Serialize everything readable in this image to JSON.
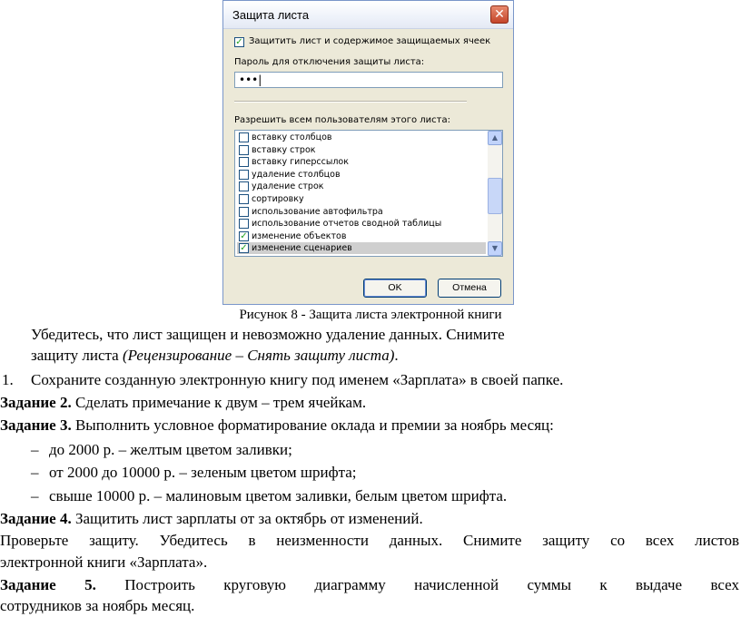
{
  "dialog": {
    "title": "Защита листа",
    "close_glyph": "✕",
    "protect_label": "Защитить лист и содержимое защищаемых ячеек",
    "protect_checked": true,
    "password_label": "Пароль для отключения защиты листа:",
    "password_value": "•••|",
    "allow_label": "Разрешить всем пользователям этого листа:",
    "allow_items": [
      {
        "label": "вставку столбцов",
        "checked": false
      },
      {
        "label": "вставку строк",
        "checked": false
      },
      {
        "label": "вставку гиперссылок",
        "checked": false
      },
      {
        "label": "удаление столбцов",
        "checked": false
      },
      {
        "label": "удаление строк",
        "checked": false
      },
      {
        "label": "сортировку",
        "checked": false
      },
      {
        "label": "использование автофильтра",
        "checked": false
      },
      {
        "label": "использование отчетов сводной таблицы",
        "checked": false
      },
      {
        "label": "изменение объектов",
        "checked": true
      },
      {
        "label": "изменение сценариев",
        "checked": true
      }
    ],
    "ok_label": "OK",
    "cancel_label": "Отмена",
    "check_glyph": "✓"
  },
  "caption": "Рисунок 8 - Защита листа электронной книги",
  "text": {
    "l1": "Убедитесь, что лист защищен и невозможно удаление данных. Снимите",
    "l2a": "защиту листа ",
    "l2b": "(Рецензирование – Снять защиту листа)",
    "l2c": ".",
    "item_num": "1.",
    "item_text": "Сохраните созданную электронную книгу под именем «Зарплата» в своей папке.",
    "t2_bold": "Задание 2.",
    "t2_text": " Сделать примечание к двум – трем ячейкам.",
    "t3_bold": "Задание 3.",
    "t3_text": " Выполнить условное форматирование оклада и премии за ноябрь месяц:",
    "dash": "–",
    "b1": "до 2000 р. – желтым цветом заливки;",
    "b2": "от 2000 до 10000 р. – зеленым цветом шрифта;",
    "b3": "свыше 10000 р. – малиновым цветом заливки, белым цветом шрифта.",
    "t4_bold": "Задание 4.",
    "t4_text": " Защитить лист зарплаты от за октябрь от изменений.",
    "check1": "Проверьте защиту. Убедитесь в неизменности данных. Снимите защиту со всех листов",
    "check2": "электронной книги «Зарплата».",
    "t5_bold": "Задание 5.",
    "t5_text": " Построить круговую диаграмму начисленной суммы к выдаче всех",
    "t5_line2": "сотрудников за ноябрь месяц."
  }
}
